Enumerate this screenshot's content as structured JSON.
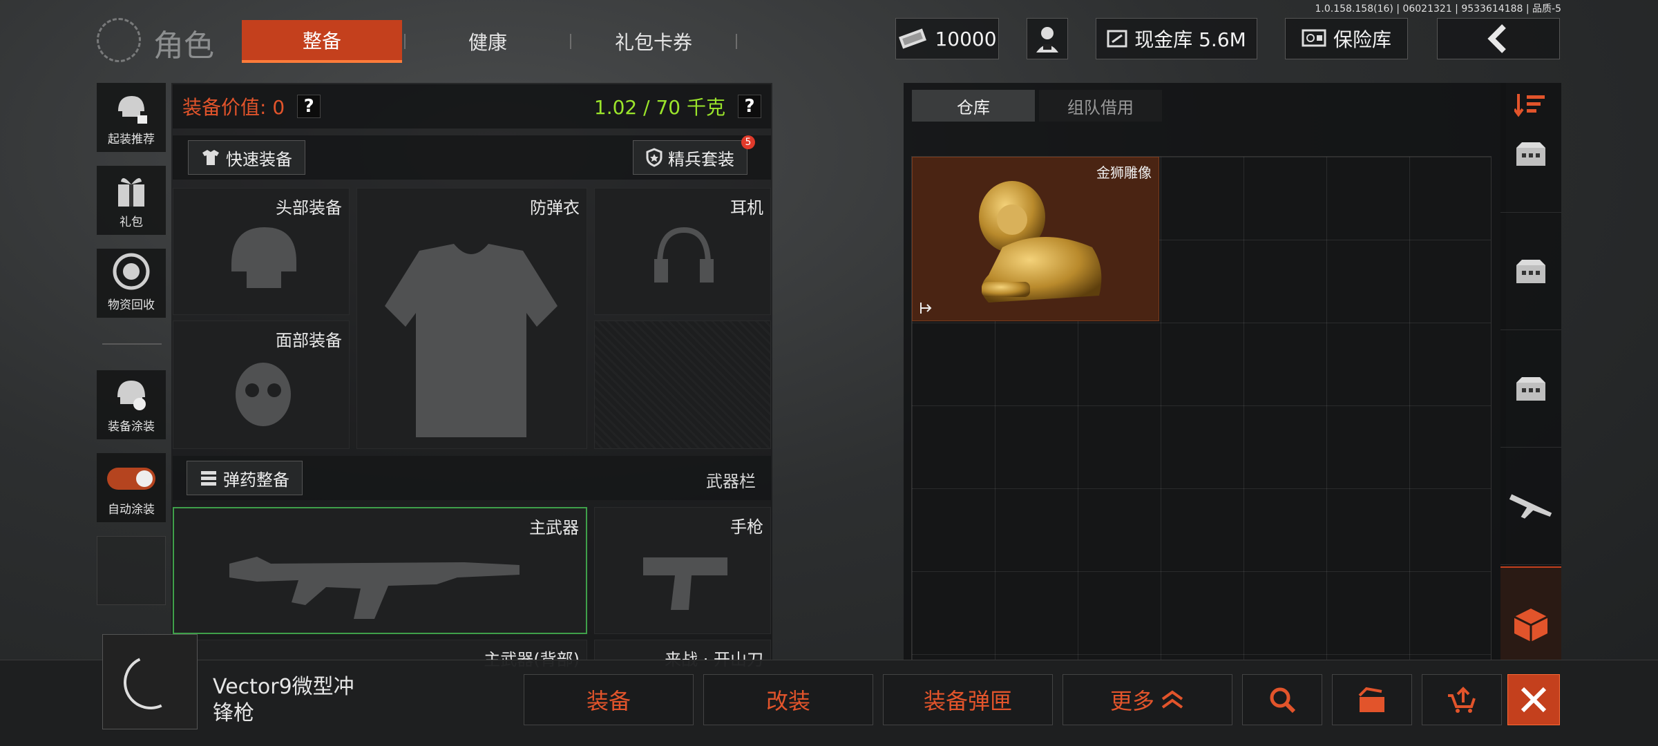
{
  "version": "1.0.158.158(16) | 06021321 | 9533614188 | 品质-5",
  "header": {
    "title": "角色",
    "tabs": [
      {
        "label": "整备",
        "active": true
      },
      {
        "label": "健康",
        "active": false
      },
      {
        "label": "礼包卡券",
        "active": false
      }
    ],
    "currency": "10000",
    "cash_vault": "现金库 5.6M",
    "safe_vault": "保险库"
  },
  "sidebar": {
    "items": [
      {
        "label": "起装推荐",
        "icon": "helmet-recommend-icon"
      },
      {
        "label": "礼包",
        "icon": "gift-icon"
      },
      {
        "label": "物资回收",
        "icon": "recycle-icon"
      },
      {
        "label": "装备涂装",
        "icon": "paint-icon"
      },
      {
        "label": "自动涂装",
        "icon": "toggle-icon",
        "toggle_on": true
      }
    ]
  },
  "equipment": {
    "value_label": "装备价值: 0",
    "weight": "1.02 / 70 千克",
    "quick_equip": "快速装备",
    "elite_set": "精兵套装",
    "elite_badge": "5",
    "slots": {
      "head": "头部装备",
      "armor": "防弹衣",
      "headset": "耳机",
      "face": "面部装备"
    },
    "ammo_button": "弹药整备",
    "weapon_bar": "武器栏",
    "primary": "主武器",
    "pistol": "手枪",
    "primary_back": "主武器(背部)",
    "melee": "来战 · 开山刀"
  },
  "warehouse": {
    "tabs": [
      {
        "label": "仓库",
        "active": true
      },
      {
        "label": "组队借用",
        "active": false
      }
    ],
    "items": [
      {
        "name": "金狮雕像"
      }
    ]
  },
  "bottom": {
    "item_name": "Vector9微型冲锋枪",
    "actions": [
      "装备",
      "改装",
      "装备弹匣",
      "更多"
    ]
  },
  "colors": {
    "accent": "#c4401d",
    "accent_text": "#e2542b",
    "weight_green": "#9be52b"
  }
}
